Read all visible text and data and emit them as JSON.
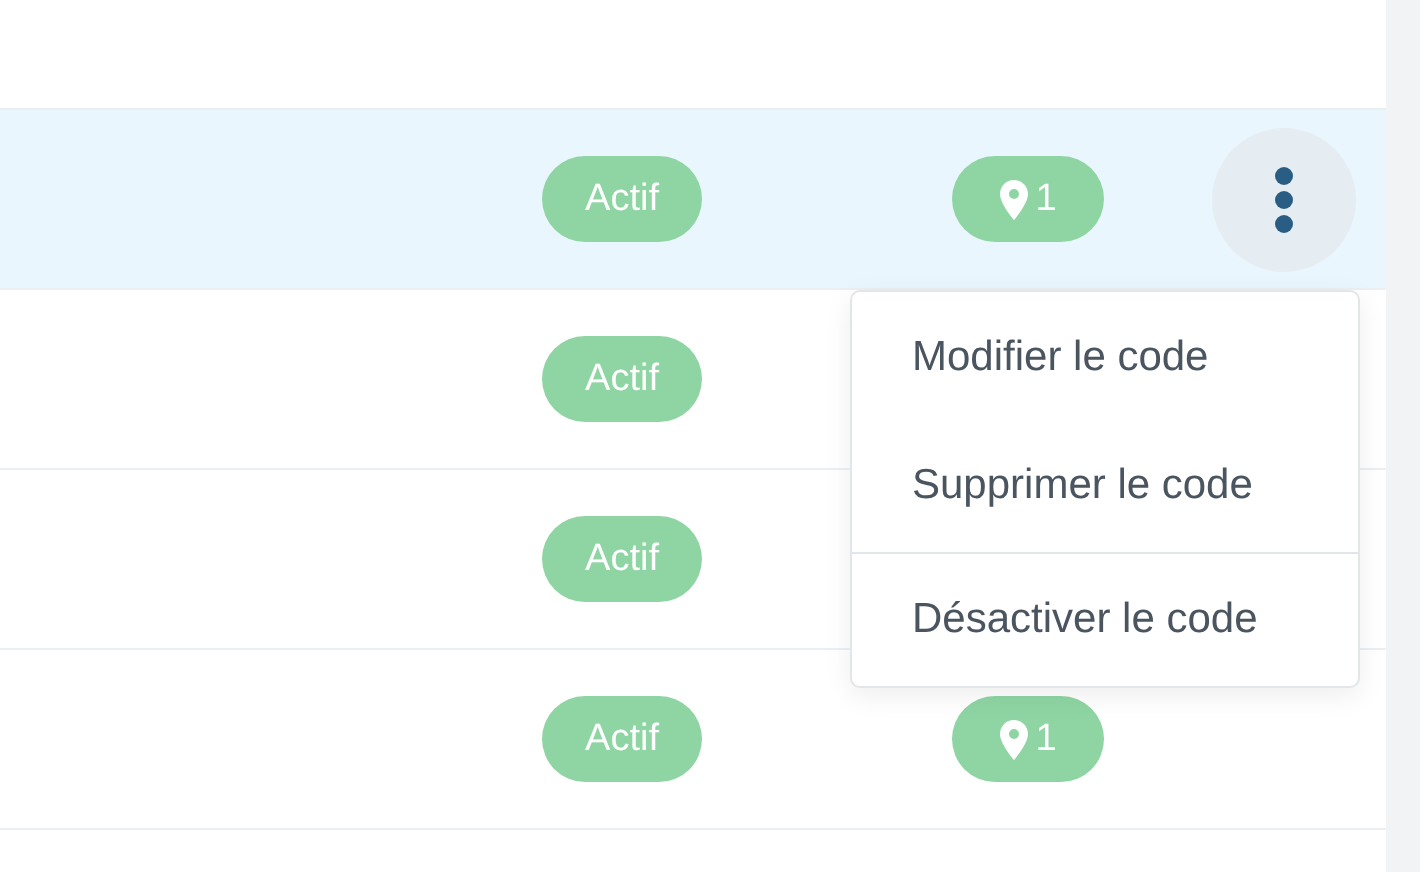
{
  "rows": [
    {
      "selected": true,
      "status": "Actif",
      "locations": "1",
      "menu_open": true
    },
    {
      "selected": false,
      "status": "Actif"
    },
    {
      "selected": false,
      "status": "Actif"
    },
    {
      "selected": false,
      "status": "Actif",
      "locations": "1"
    }
  ],
  "menu": {
    "sections": [
      [
        "Modifier le code",
        "Supprimer le code"
      ],
      [
        "Désactiver le code"
      ]
    ]
  }
}
